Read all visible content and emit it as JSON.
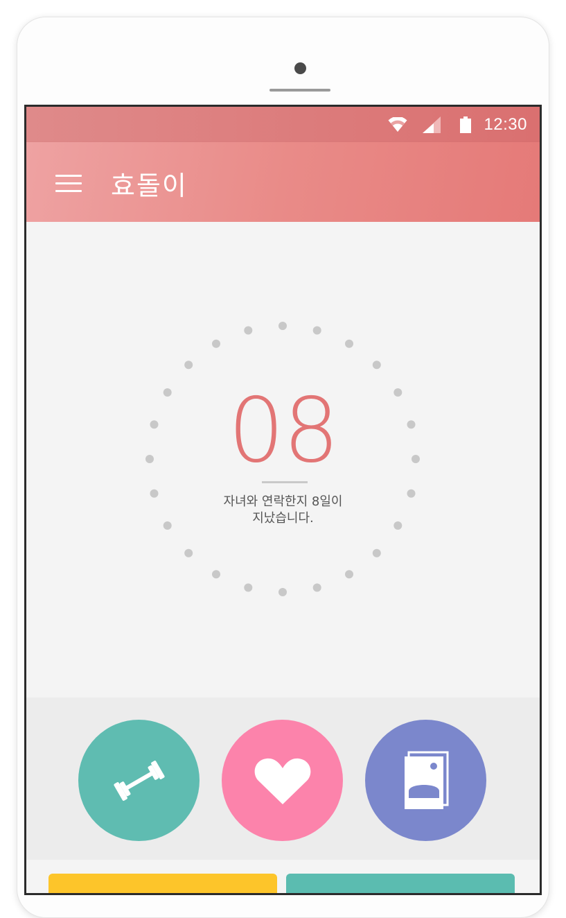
{
  "status_bar": {
    "time": "12:30",
    "icons": [
      "wifi-icon",
      "cell-signal-icon",
      "battery-icon"
    ],
    "color": "#da7070"
  },
  "app_bar": {
    "title": "효돌이",
    "menu_icon": "hamburger-menu-icon",
    "gradient": [
      "#eea2a2",
      "#e57a78"
    ]
  },
  "counter": {
    "days": "08",
    "message_line1": "자녀와 연락한지 8일이",
    "message_line2": "지났습니다.",
    "accent_color": "#e27575"
  },
  "actions": [
    {
      "icon": "dumbbell-icon",
      "color": "#5fbcb1"
    },
    {
      "icon": "heart-icon",
      "color": "#fc83ab"
    },
    {
      "icon": "photo-gallery-icon",
      "color": "#7b87cc"
    }
  ],
  "bottom_cards": [
    {
      "color": "#fdc52a"
    },
    {
      "color": "#5bbcb0"
    }
  ]
}
